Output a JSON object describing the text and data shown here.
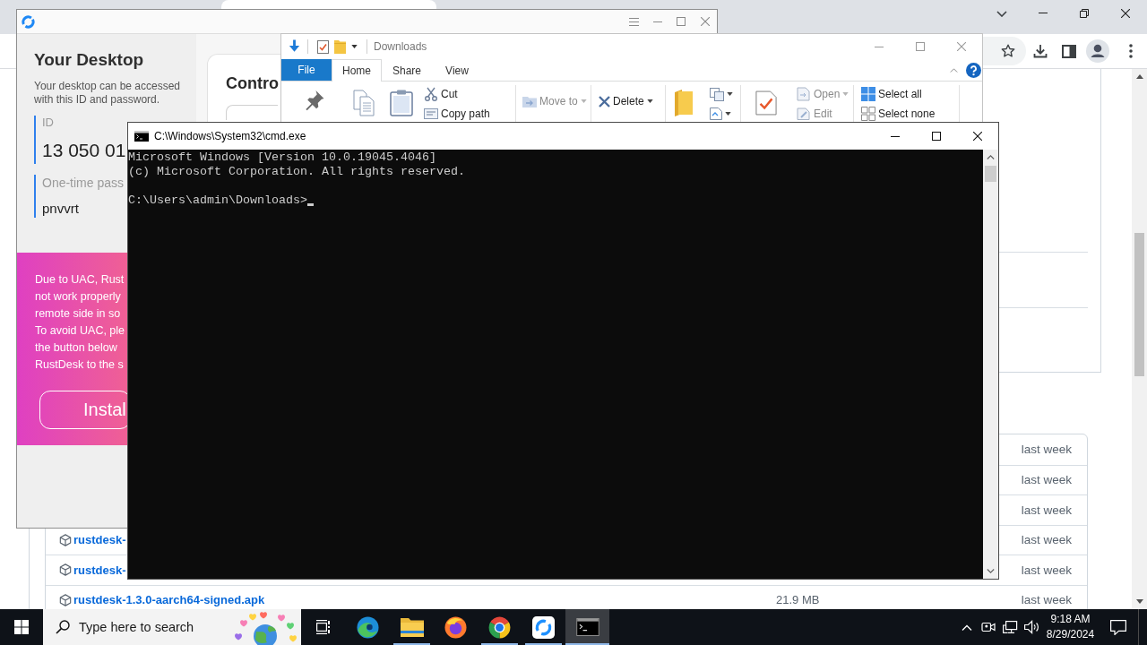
{
  "browser": {
    "file_table": {
      "rows": [
        {
          "date": "last week"
        },
        {
          "date": "last week"
        },
        {
          "date": "last week"
        },
        {
          "name": "rustdesk-",
          "date": "last week"
        },
        {
          "name": "rustdesk-",
          "date": "last week"
        },
        {
          "name": "rustdesk-1.3.0-aarch64-signed.apk",
          "size": "21.9 MB",
          "date": "last week"
        }
      ]
    }
  },
  "rustdesk": {
    "sidebar": {
      "title": "Your Desktop",
      "description": "Your desktop can be accessed with this ID and password.",
      "id_label": "ID",
      "id_value": "13 050 01",
      "password_label": "One-time pass",
      "password_value": "pnvvrt"
    },
    "banner": {
      "lines": [
        "Due to UAC, Rust",
        "not work properly",
        "remote side in so",
        "To avoid UAC, ple",
        "the button below",
        "RustDesk to the s"
      ],
      "button": "Instal"
    },
    "main": {
      "card_title": "Contro"
    }
  },
  "explorer": {
    "title": "Downloads",
    "tabs": [
      {
        "label": "File",
        "kind": "file",
        "selected": false
      },
      {
        "label": "Home",
        "kind": "tab",
        "selected": true
      },
      {
        "label": "Share",
        "kind": "tab",
        "selected": false
      },
      {
        "label": "View",
        "kind": "tab",
        "selected": false
      }
    ],
    "ribbon_groups": [
      {
        "commands": [
          {
            "label": "Cut",
            "dropdown": false,
            "disabled": false
          },
          {
            "label": "Copy path",
            "dropdown": false,
            "disabled": false
          }
        ]
      },
      {
        "commands": [
          {
            "label": "Move to",
            "dropdown": true,
            "disabled": true
          }
        ]
      },
      {
        "commands": [
          {
            "label": "Delete",
            "dropdown": true,
            "disabled": false
          }
        ]
      },
      {
        "commands": [
          {
            "label": "Open",
            "dropdown": true,
            "disabled": true
          },
          {
            "label": "Edit",
            "dropdown": false,
            "disabled": true
          }
        ]
      },
      {
        "commands": [
          {
            "label": "Select all",
            "dropdown": false,
            "disabled": false
          },
          {
            "label": "Select none",
            "dropdown": false,
            "disabled": false
          }
        ]
      }
    ]
  },
  "cmd": {
    "title": "C:\\Windows\\System32\\cmd.exe",
    "output": [
      "Microsoft Windows [Version 10.0.19045.4046]",
      "(c) Microsoft Corporation. All rights reserved."
    ],
    "prompt": "C:\\Users\\admin\\Downloads>"
  },
  "taskbar": {
    "search": {
      "placeholder": "Type here to search"
    },
    "apps": [
      {
        "kind": "edge",
        "running": false,
        "selected": false
      },
      {
        "kind": "explorer",
        "running": true,
        "selected": false
      },
      {
        "kind": "firefox",
        "running": false,
        "selected": false
      },
      {
        "kind": "chrome",
        "running": true,
        "selected": false
      },
      {
        "kind": "rustdesk",
        "running": true,
        "selected": false
      },
      {
        "kind": "cmd",
        "running": true,
        "selected": true
      }
    ],
    "clock": {
      "time": "9:18 AM",
      "date": "8/29/2024"
    }
  }
}
